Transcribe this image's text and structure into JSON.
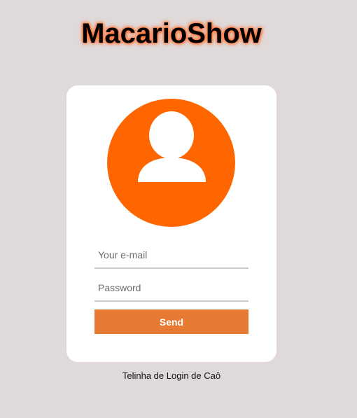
{
  "header": {
    "title": "MacarioShow"
  },
  "login": {
    "avatar_icon": "user-icon",
    "email_placeholder": "Your e-mail",
    "email_value": "",
    "password_placeholder": "Password",
    "password_value": "",
    "send_label": "Send"
  },
  "footer": {
    "caption": "Telinha de Login de Caô"
  },
  "colors": {
    "background": "#e0d9da",
    "accent": "#ff6600",
    "button": "#e67a33",
    "card": "#ffffff"
  }
}
